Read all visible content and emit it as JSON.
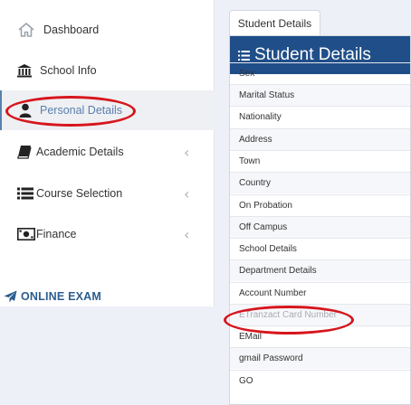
{
  "sidebar": {
    "items": [
      {
        "label": "Dashboard",
        "icon": "home-icon"
      },
      {
        "label": "School Info",
        "icon": "bank-icon"
      },
      {
        "label": "Personal Details",
        "icon": "user-icon"
      },
      {
        "label": "Academic Details",
        "icon": "book-icon"
      },
      {
        "label": "Course Selection",
        "icon": "list-icon"
      },
      {
        "label": "Finance",
        "icon": "money-icon"
      }
    ],
    "online_exam": "ONLINE EXAM"
  },
  "tab": {
    "label": "Student Details"
  },
  "panel": {
    "title": "Student Details",
    "rows": [
      "Sex",
      "Marital Status",
      "Nationality",
      "Address",
      "Town",
      "Country",
      "On Probation",
      "Off Campus",
      "School Details",
      "Department Details",
      "Account Number",
      "ETranzact Card Number",
      "EMail",
      "gmail Password",
      "GO"
    ]
  },
  "colors": {
    "accent": "#1f4e88",
    "active_text": "#5a7fae",
    "annotation_ring": "#d7151c"
  }
}
